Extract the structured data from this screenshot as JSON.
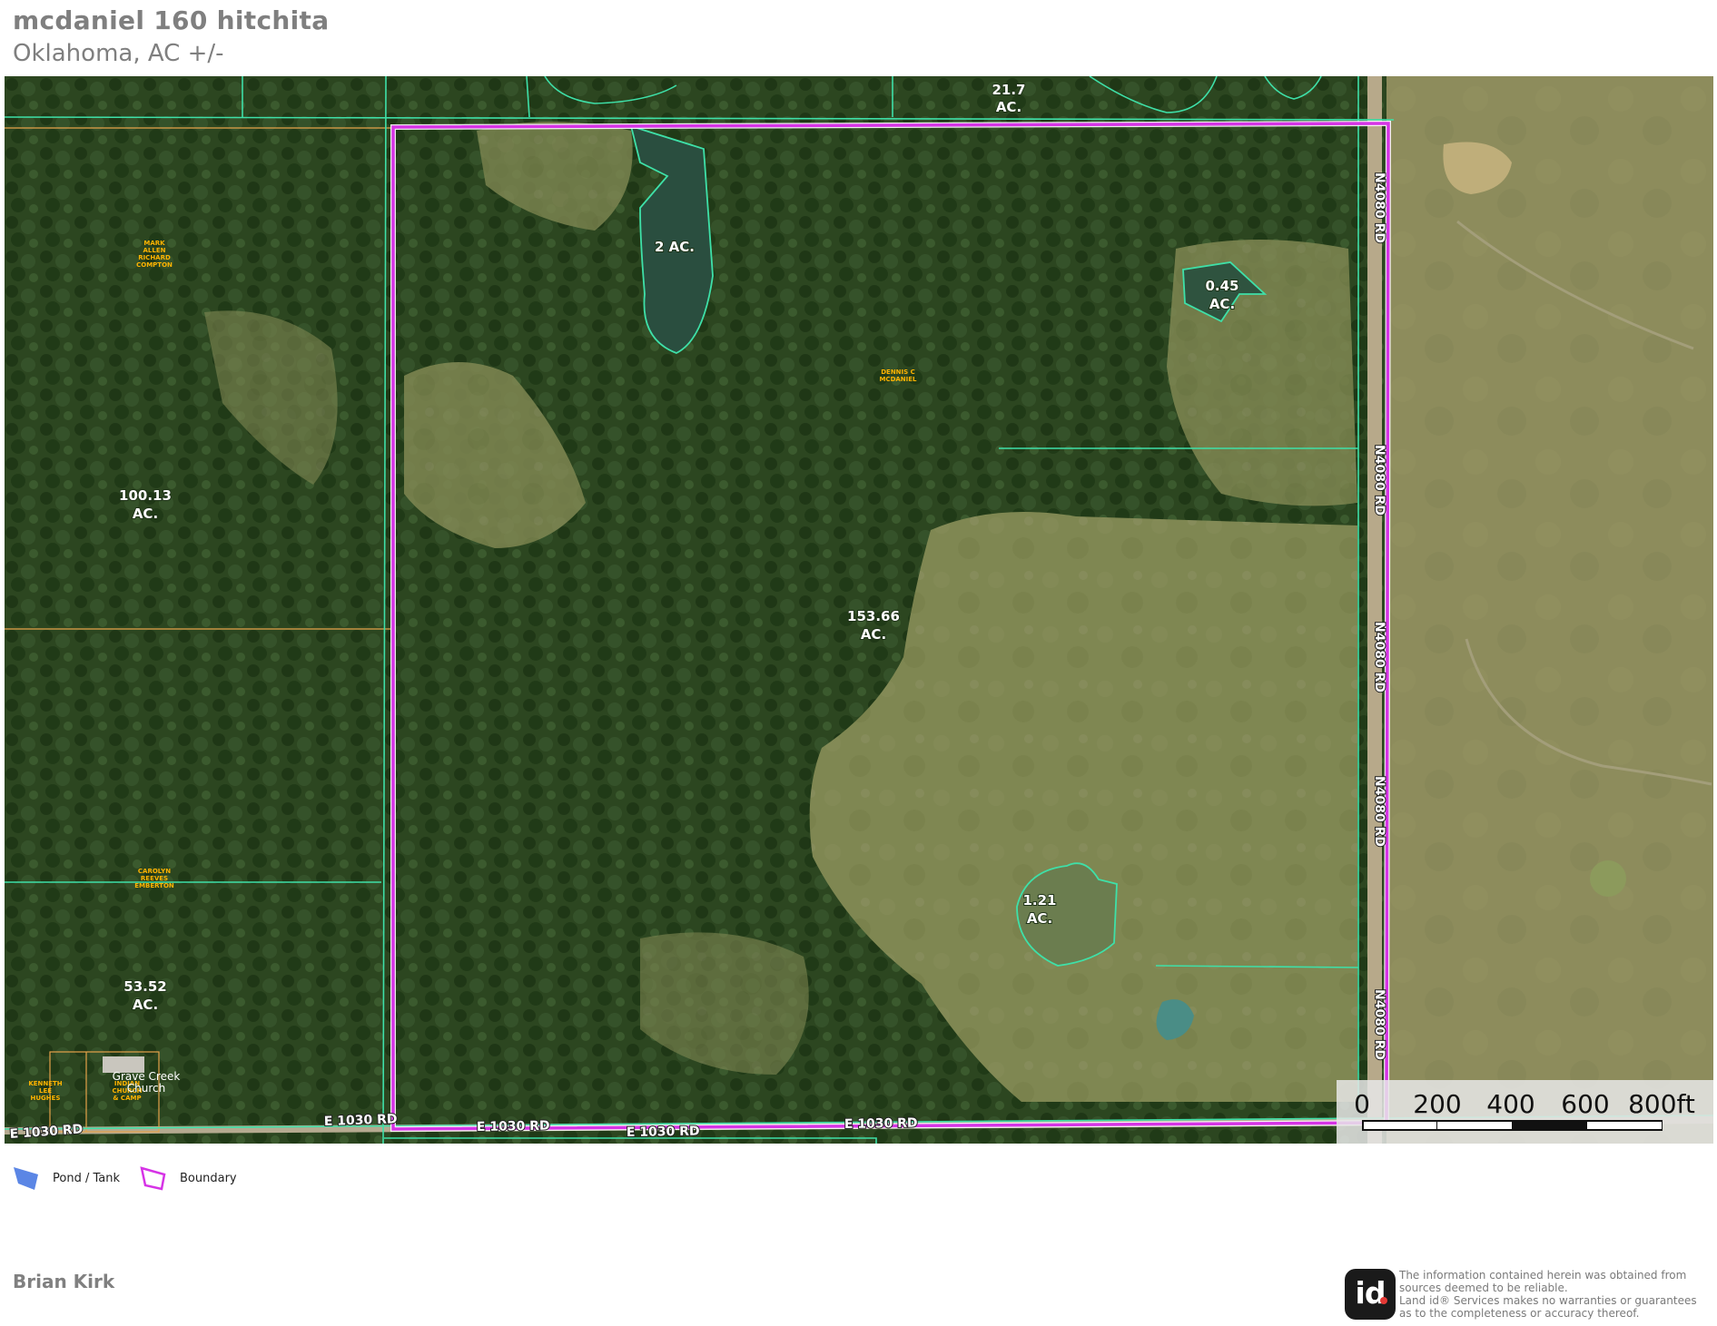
{
  "title": "mcdaniel 160 hitchita",
  "subtitle": "Oklahoma,  AC +/-",
  "parcels": {
    "main_label": "153.66",
    "west_label": "100.13",
    "southwest_label": "53.52",
    "north_label": "21.7",
    "unit": "AC."
  },
  "ponds": {
    "north_label": "2 AC.",
    "northeast_label": "0.45",
    "southeast_label": "1.21",
    "unit": "AC."
  },
  "owners": {
    "compton": [
      "MARK",
      "ALLEN",
      "RICHARD",
      "COMPTON"
    ],
    "mcdaniel": [
      "DENNIS C",
      "MCDANIEL"
    ],
    "emberton": [
      "CAROLYN",
      "REEVES",
      "EMBERTON"
    ],
    "hughes": [
      "KENNETH",
      "LEE",
      "HUGHES"
    ],
    "church": [
      "INDIAN",
      "CHURCH",
      "& CAMP"
    ]
  },
  "places": {
    "church_name": [
      "Grave Creek",
      "Church"
    ]
  },
  "roads": {
    "east_road": "N4080 RD",
    "south_road_west": "E 1030 RD",
    "south_road_mid": "E 1030 RD",
    "south_road_2": "E 1030 RD",
    "south_road_3": "E 1030 RD",
    "south_road_4": "E 1030 RD"
  },
  "scale": {
    "ticks": [
      "0",
      "200",
      "400",
      "600",
      "800ft"
    ]
  },
  "legend": {
    "pond": "Pond / Tank",
    "boundary": "Boundary"
  },
  "colors": {
    "boundary": "#d633e6",
    "parcel_line": "#3ee0a8",
    "owner_line": "#e5a24a",
    "pond_legend": "#5b86e5"
  },
  "author": "Brian Kirk",
  "logo_text": "id",
  "disclaimer": [
    "The information contained herein was obtained from",
    "sources deemed to be reliable.",
    " Land id® Services makes no warranties or guarantees",
    "as to the completeness or accuracy thereof."
  ]
}
